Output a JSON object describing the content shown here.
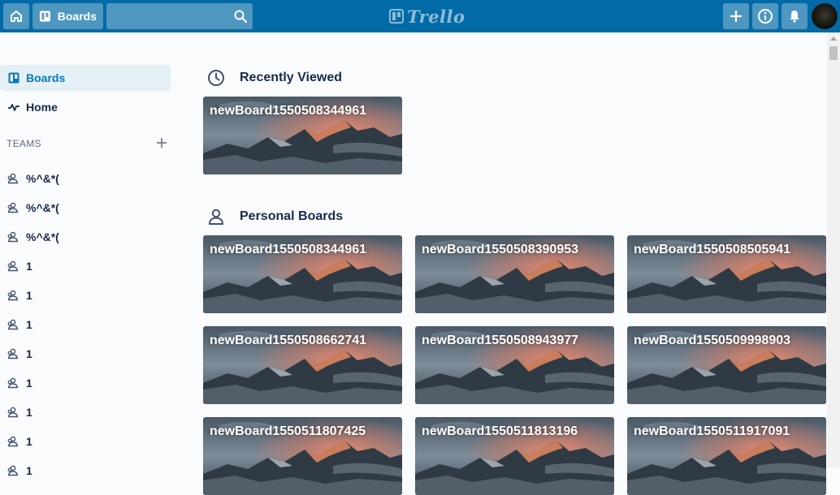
{
  "header": {
    "boards_label": "Boards",
    "search_value": "",
    "logo_text": "Trello"
  },
  "sidebar": {
    "nav": [
      {
        "label": "Boards",
        "icon": "board-icon",
        "active": true
      },
      {
        "label": "Home",
        "icon": "activity-icon",
        "active": false
      }
    ],
    "teams_header": "TEAMS",
    "teams": [
      "%^&*(",
      "%^&*(",
      "%^&*(",
      "1",
      "1",
      "1",
      "1",
      "1",
      "1",
      "1",
      "1"
    ]
  },
  "main": {
    "recent": {
      "title": "Recently Viewed",
      "boards": [
        "newBoard1550508344961"
      ]
    },
    "personal": {
      "title": "Personal Boards",
      "boards": [
        "newBoard1550508344961",
        "newBoard1550508390953",
        "newBoard1550508505941",
        "newBoard1550508662741",
        "newBoard1550508943977",
        "newBoard1550509998903",
        "newBoard1550511807425",
        "newBoard1550511813196",
        "newBoard1550511917091"
      ]
    }
  },
  "colors": {
    "header": "#026aa7",
    "active_nav_bg": "#e4f0f6",
    "active_nav_text": "#0079bf",
    "text": "#172b4d"
  }
}
